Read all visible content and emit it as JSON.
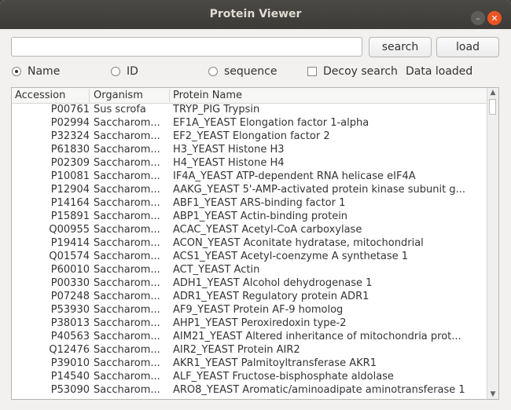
{
  "window": {
    "title": "Protein Viewer"
  },
  "toolbar": {
    "search_value": "",
    "search_label": "search",
    "load_label": "load"
  },
  "options": {
    "name_label": "Name",
    "id_label": "ID",
    "sequence_label": "sequence",
    "decoy_label": "Decoy search",
    "status_text": "Data loaded",
    "selected": "Name"
  },
  "table": {
    "headers": [
      "Accession",
      "Organism",
      "Protein Name"
    ],
    "rows": [
      [
        "P00761",
        "Sus scrofa",
        "TRYP_PIG Trypsin"
      ],
      [
        "P02994",
        "Saccharom...",
        "EF1A_YEAST Elongation factor 1-alpha"
      ],
      [
        "P32324",
        "Saccharom...",
        "EF2_YEAST Elongation factor 2"
      ],
      [
        "P61830",
        "Saccharom...",
        "H3_YEAST Histone H3"
      ],
      [
        "P02309",
        "Saccharom...",
        "H4_YEAST Histone H4"
      ],
      [
        "P10081",
        "Saccharom...",
        "IF4A_YEAST ATP-dependent RNA helicase eIF4A"
      ],
      [
        "P12904",
        "Saccharom...",
        "AAKG_YEAST 5'-AMP-activated protein kinase subunit g..."
      ],
      [
        "P14164",
        "Saccharom...",
        "ABF1_YEAST ARS-binding factor 1"
      ],
      [
        "P15891",
        "Saccharom...",
        "ABP1_YEAST Actin-binding protein"
      ],
      [
        "Q00955",
        "Saccharom...",
        "ACAC_YEAST Acetyl-CoA carboxylase"
      ],
      [
        "P19414",
        "Saccharom...",
        "ACON_YEAST Aconitate hydratase, mitochondrial"
      ],
      [
        "Q01574",
        "Saccharom...",
        "ACS1_YEAST Acetyl-coenzyme A synthetase 1"
      ],
      [
        "P60010",
        "Saccharom...",
        "ACT_YEAST Actin"
      ],
      [
        "P00330",
        "Saccharom...",
        "ADH1_YEAST Alcohol dehydrogenase 1"
      ],
      [
        "P07248",
        "Saccharom...",
        "ADR1_YEAST Regulatory protein ADR1"
      ],
      [
        "P53930",
        "Saccharom...",
        "AF9_YEAST Protein AF-9 homolog"
      ],
      [
        "P38013",
        "Saccharom...",
        "AHP1_YEAST Peroxiredoxin type-2"
      ],
      [
        "P40563",
        "Saccharom...",
        "AIM21_YEAST Altered inheritance of mitochondria prot..."
      ],
      [
        "Q12476",
        "Saccharom...",
        "AIR2_YEAST Protein AIR2"
      ],
      [
        "P39010",
        "Saccharom...",
        "AKR1_YEAST Palmitoyltransferase AKR1"
      ],
      [
        "P14540",
        "Saccharom...",
        "ALF_YEAST Fructose-bisphosphate aldolase"
      ],
      [
        "P53090",
        "Saccharom...",
        "ARO8_YEAST Aromatic/aminoadipate aminotransferase 1"
      ]
    ]
  }
}
